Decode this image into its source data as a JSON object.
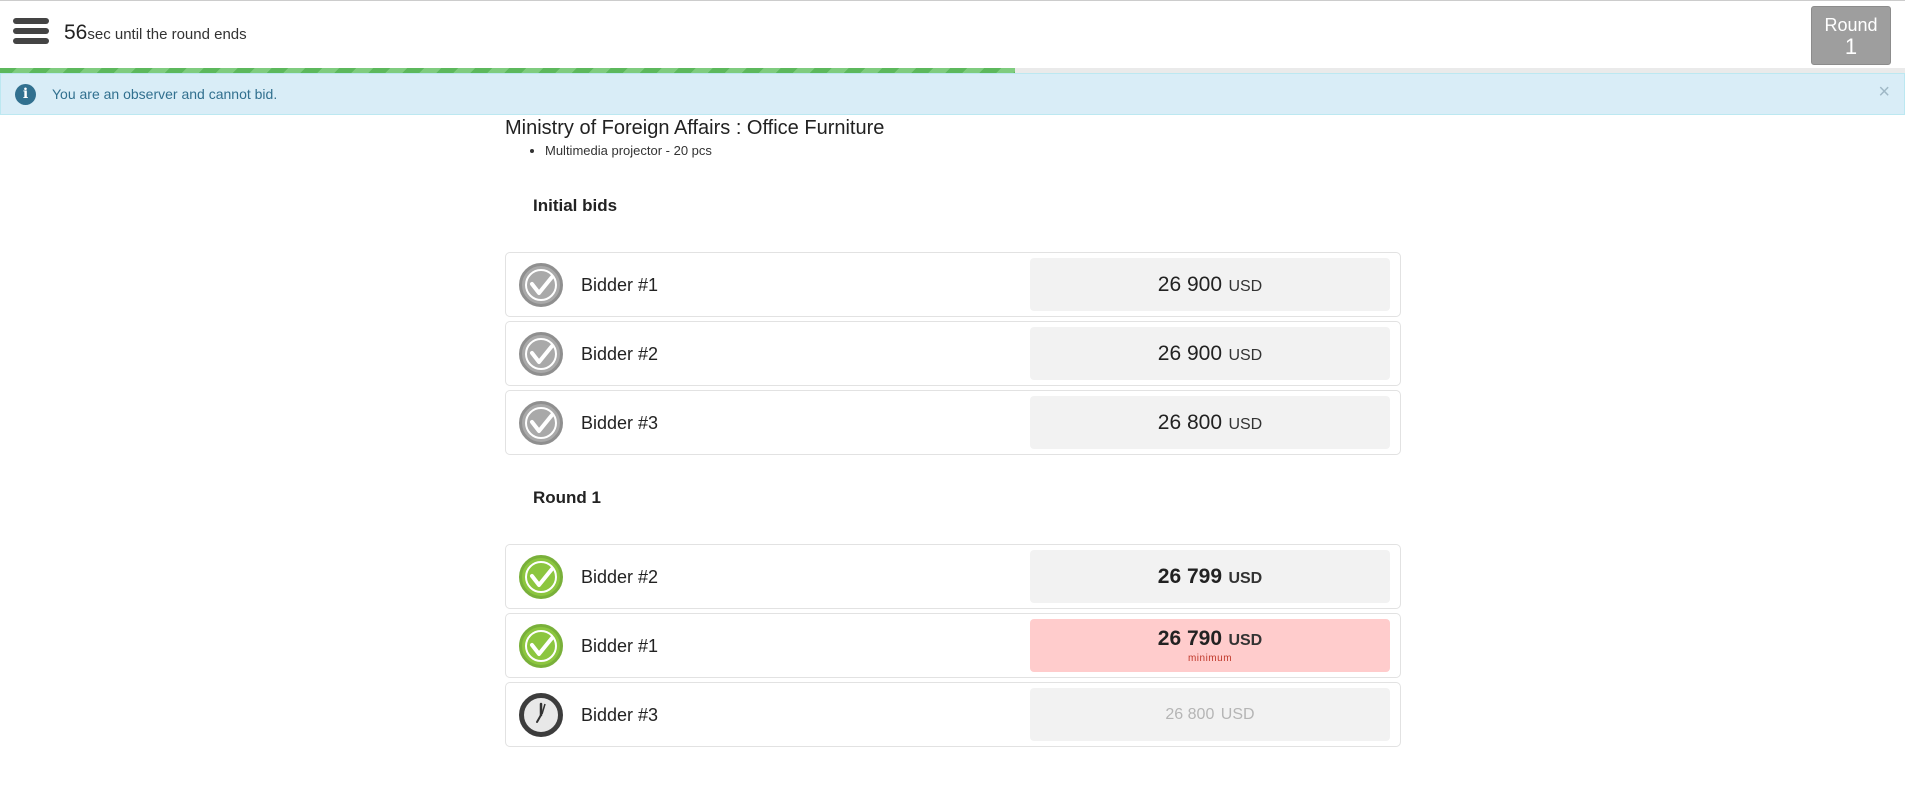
{
  "header": {
    "timer_value": "56",
    "timer_text": "sec until the round ends",
    "round_label": "Round",
    "round_number": "1",
    "progress_fraction": 0.533
  },
  "alert": {
    "message": "You are an observer and cannot bid.",
    "close_symbol": "×"
  },
  "auction": {
    "title": "Ministry of Foreign Affairs : Office Furniture",
    "items": [
      "Multimedia projector - 20 pcs"
    ]
  },
  "initial": {
    "section_title": "Initial bids",
    "bids": [
      {
        "bidder": "Bidder #1",
        "amount": "26 900",
        "currency": "USD",
        "status": "grey-check-icon"
      },
      {
        "bidder": "Bidder #2",
        "amount": "26 900",
        "currency": "USD",
        "status": "grey-check-icon"
      },
      {
        "bidder": "Bidder #3",
        "amount": "26 800",
        "currency": "USD",
        "status": "grey-check-icon"
      }
    ]
  },
  "round1": {
    "section_title": "Round 1",
    "bids": [
      {
        "bidder": "Bidder #2",
        "amount": "26 799",
        "currency": "USD",
        "status": "green-check-icon"
      },
      {
        "bidder": "Bidder #1",
        "amount": "26 790",
        "currency": "USD",
        "note": "minimum",
        "status": "green-check-icon"
      },
      {
        "bidder": "Bidder #3",
        "amount": "26 800",
        "currency": "USD",
        "status": "clock-icon"
      }
    ]
  },
  "colors": {
    "progress": "#5cb85c",
    "alert_bg": "#d9edf7",
    "alert_text": "#31708f",
    "minimum_bg": "#ffcccc",
    "check_green": "#8cc63f",
    "check_grey": "#a9a9a9"
  }
}
